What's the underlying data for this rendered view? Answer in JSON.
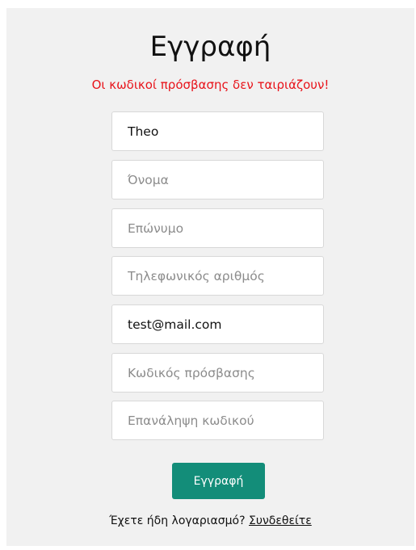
{
  "form": {
    "title": "Εγγραφή",
    "error_message": "Οι κωδικοί πρόσβασης δεν ταιριάζουν!",
    "fields": {
      "username": {
        "value": "Theo",
        "placeholder": ""
      },
      "first_name": {
        "value": "",
        "placeholder": "Όνομα"
      },
      "last_name": {
        "value": "",
        "placeholder": "Επώνυμο"
      },
      "phone": {
        "value": "",
        "placeholder": "Τηλεφωνικός αριθμός"
      },
      "email": {
        "value": "test@mail.com",
        "placeholder": ""
      },
      "password": {
        "value": "",
        "placeholder": "Κωδικός πρόσβασης"
      },
      "password_repeat": {
        "value": "",
        "placeholder": "Επανάληψη κωδικού"
      }
    },
    "submit_label": "Εγγραφή",
    "login_prompt": "Έχετε ήδη λογαριασμό?",
    "login_link": "Συνδεθείτε"
  },
  "colors": {
    "panel_bg": "#f1f1f1",
    "error": "#e8141b",
    "button_bg": "#138d79",
    "button_text": "#ffffff"
  }
}
